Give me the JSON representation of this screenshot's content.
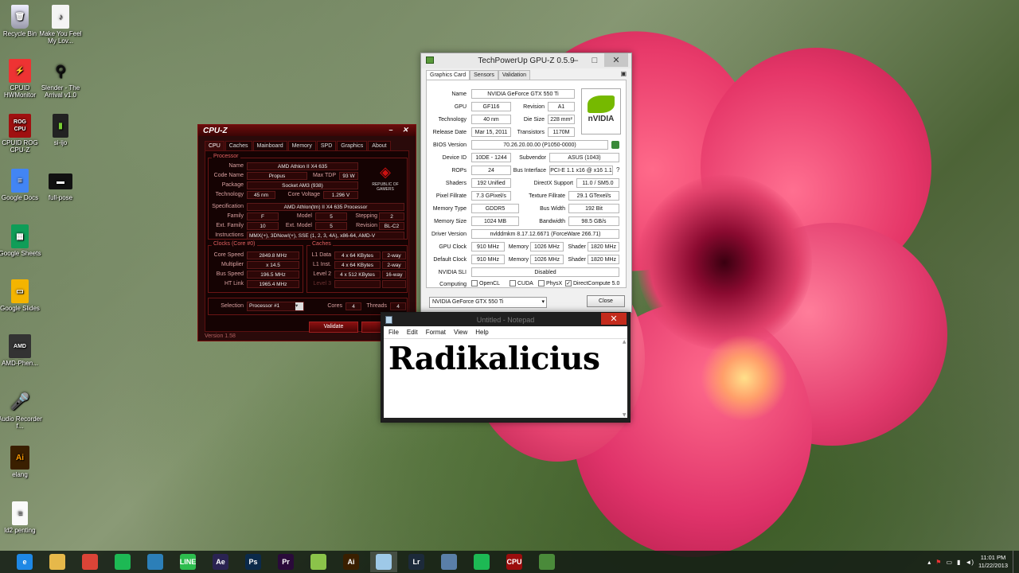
{
  "desktop": {
    "icons": [
      {
        "label": "Recycle Bin",
        "icon": "recycle-bin-icon"
      },
      {
        "label": "Make You Feel My Lov...",
        "icon": "mp3-file-icon"
      },
      {
        "label": "CPUID HWMonitor",
        "icon": "hwmonitor-icon"
      },
      {
        "label": "Slender - The Arrival v1.0",
        "icon": "slender-icon"
      },
      {
        "label": "CPUID ROG CPU-Z",
        "icon": "rog-cpuz-icon"
      },
      {
        "label": "si-ijo",
        "icon": "folder-icon"
      },
      {
        "label": "Google Docs",
        "icon": "google-docs-icon"
      },
      {
        "label": "full-pose",
        "icon": "image-file-icon"
      },
      {
        "label": "Google Sheets",
        "icon": "google-sheets-icon"
      },
      {
        "label": "Google Slides",
        "icon": "google-slides-icon"
      },
      {
        "label": "AMD-Phen...",
        "icon": "amd-image-icon"
      },
      {
        "label": "Audio Recorder f...",
        "icon": "audio-recorder-icon"
      },
      {
        "label": "elang",
        "icon": "illustrator-file-icon"
      },
      {
        "label": "ld2 penting",
        "icon": "text-file-icon"
      }
    ]
  },
  "cpuz": {
    "title": "CPU-Z",
    "tabs": [
      "CPU",
      "Caches",
      "Mainboard",
      "Memory",
      "SPD",
      "Graphics",
      "About"
    ],
    "processor_group": "Processor",
    "name_label": "Name",
    "name": "AMD Athlon II X4 635",
    "codename_label": "Code Name",
    "codename": "Propus",
    "maxtdp_label": "Max TDP",
    "maxtdp": "93 W",
    "package_label": "Package",
    "package": "Socket AM3 (938)",
    "technology_label": "Technology",
    "technology": "45 nm",
    "corevoltage_label": "Core Voltage",
    "corevoltage": "1.296 V",
    "spec_label": "Specification",
    "spec": "AMD Athlon(tm) II X4 635 Processor",
    "family_label": "Family",
    "family": "F",
    "model_label": "Model",
    "model": "5",
    "stepping_label": "Stepping",
    "stepping": "2",
    "extfamily_label": "Ext. Family",
    "extfamily": "10",
    "extmodel_label": "Ext. Model",
    "extmodel": "5",
    "revision_label": "Revision",
    "revision": "BL-C2",
    "instructions_label": "Instructions",
    "instructions": "MMX(+), 3DNow!(+), SSE (1, 2, 3, 4A), x86-64, AMD-V",
    "clocks_group": "Clocks (Core #0)",
    "corespeed_label": "Core Speed",
    "corespeed": "2849.8 MHz",
    "multiplier_label": "Multiplier",
    "multiplier": "x 14.5",
    "busspeed_label": "Bus Speed",
    "busspeed": "196.5 MHz",
    "htlink_label": "HT Link",
    "htlink": "1965.4 MHz",
    "caches_group": "Caches",
    "l1data_label": "L1 Data",
    "l1data": "4 x 64 KBytes",
    "l1data_way": "2-way",
    "l1inst_label": "L1 Inst.",
    "l1inst": "4 x 64 KBytes",
    "l1inst_way": "2-way",
    "level2_label": "Level 2",
    "level2": "4 x 512 KBytes",
    "level2_way": "16-way",
    "level3_label": "Level 3",
    "selection_label": "Selection",
    "selection": "Processor #1",
    "cores_label": "Cores",
    "cores": "4",
    "threads_label": "Threads",
    "threads": "4",
    "validate": "Validate",
    "version": "Version 1.58",
    "rog_logo": "REPUBLIC OF GAMERS"
  },
  "gpuz": {
    "title": "TechPowerUp GPU-Z 0.5.9",
    "tabs": [
      "Graphics Card",
      "Sensors",
      "Validation"
    ],
    "name_label": "Name",
    "name": "NVIDIA GeForce GTX 550 Ti",
    "gpu_label": "GPU",
    "gpu": "GF116",
    "revision_label": "Revision",
    "revision": "A1",
    "technology_label": "Technology",
    "technology": "40 nm",
    "diesize_label": "Die Size",
    "diesize": "228 mm²",
    "releasedate_label": "Release Date",
    "releasedate": "Mar 15, 2011",
    "transistors_label": "Transistors",
    "transistors": "1170M",
    "bios_label": "BIOS Version",
    "bios": "70.26.20.00.00 (P1050-0000)",
    "deviceid_label": "Device ID",
    "deviceid": "10DE - 1244",
    "subvendor_label": "Subvendor",
    "subvendor": "ASUS (1043)",
    "rops_label": "ROPs",
    "rops": "24",
    "businterface_label": "Bus Interface",
    "businterface": "PCI-E 1.1 x16 @ x16 1.1",
    "shaders_label": "Shaders",
    "shaders": "192 Unified",
    "directx_label": "DirectX Support",
    "directx": "11.0 / SM5.0",
    "pixelfill_label": "Pixel Fillrate",
    "pixelfill": "7.3 GPixel/s",
    "texturefill_label": "Texture Fillrate",
    "texturefill": "29.1 GTexel/s",
    "memtype_label": "Memory Type",
    "memtype": "GDDR5",
    "buswidth_label": "Bus Width",
    "buswidth": "192 Bit",
    "memsize_label": "Memory Size",
    "memsize": "1024 MB",
    "bandwidth_label": "Bandwidth",
    "bandwidth": "98.5 GB/s",
    "driver_label": "Driver Version",
    "driver": "nvlddmkm 8.17.12.6671 (ForceWare 266.71)",
    "gpuclock_label": "GPU Clock",
    "gpuclock": "910 MHz",
    "memory_label": "Memory",
    "memclock": "1026 MHz",
    "shader_label": "Shader",
    "shaderclock": "1820 MHz",
    "defclock_label": "Default Clock",
    "defclock": "910 MHz",
    "defmemclock": "1026 MHz",
    "defshaderclock": "1820 MHz",
    "sli_label": "NVIDIA SLI",
    "sli": "Disabled",
    "computing_label": "Computing",
    "opencl": "OpenCL",
    "cuda": "CUDA",
    "physx": "PhysX",
    "directcompute": "DirectCompute 5.0",
    "question": "?",
    "card_select": "NVIDIA GeForce GTX 550 Ti",
    "close": "Close",
    "nvidia_logo": "nVIDIA"
  },
  "notepad": {
    "title": "Untitled - Notepad",
    "menu": [
      "File",
      "Edit",
      "Format",
      "View",
      "Help"
    ],
    "content": "Radikalicius"
  },
  "taskbar": {
    "apps": [
      {
        "name": "internet-explorer",
        "label": "e",
        "color": "#1e88e5"
      },
      {
        "name": "file-explorer",
        "label": "",
        "color": "#e6b84a"
      },
      {
        "name": "chrome",
        "label": "",
        "color": "#db4437"
      },
      {
        "name": "spotify",
        "label": "",
        "color": "#1db954"
      },
      {
        "name": "app-blue",
        "label": "",
        "color": "#2c7fb8"
      },
      {
        "name": "line",
        "label": "LINE",
        "color": "#2dbd4e"
      },
      {
        "name": "after-effects",
        "label": "Ae",
        "color": "#2a2352"
      },
      {
        "name": "photoshop",
        "label": "Ps",
        "color": "#0b2a4a"
      },
      {
        "name": "premiere",
        "label": "Pr",
        "color": "#2a0a3a"
      },
      {
        "name": "app-green",
        "label": "",
        "color": "#8bc34a"
      },
      {
        "name": "illustrator",
        "label": "Ai",
        "color": "#3a1f00"
      },
      {
        "name": "notepad",
        "label": "",
        "color": "#9ec9e8"
      },
      {
        "name": "lightroom",
        "label": "Lr",
        "color": "#1c2a3a"
      },
      {
        "name": "network-app",
        "label": "",
        "color": "#5a7fa8"
      },
      {
        "name": "spotify-2",
        "label": "",
        "color": "#1db954"
      },
      {
        "name": "rog-cpuz",
        "label": "CPU",
        "color": "#9b0d0d"
      },
      {
        "name": "gpuz",
        "label": "",
        "color": "#4a8a3a"
      }
    ],
    "time": "11:01 PM",
    "date": "11/22/2013"
  }
}
